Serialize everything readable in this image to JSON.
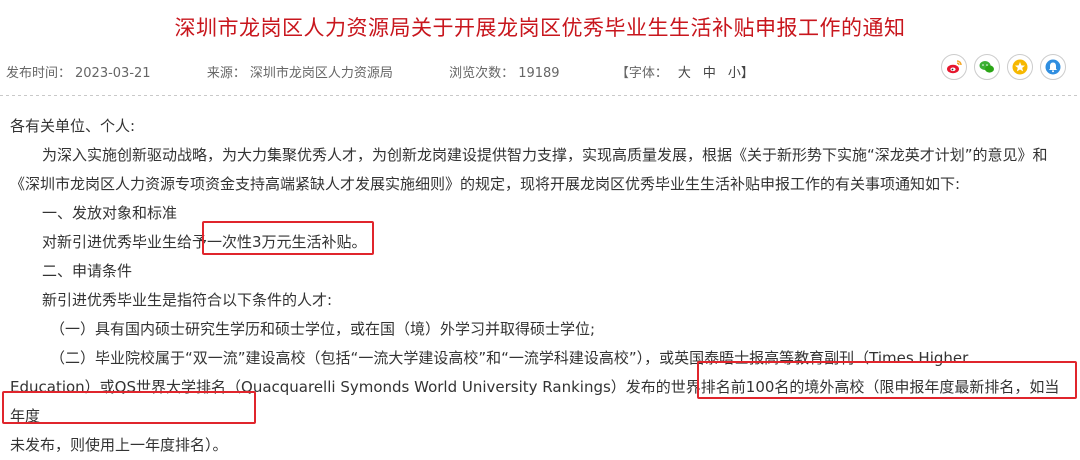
{
  "title": "深圳市龙岗区人力资源局关于开展龙岗区优秀毕业生生活补贴申报工作的通知",
  "meta": {
    "publish_label": "发布时间：",
    "publish_date": "2023-03-21",
    "source_label": "来源：",
    "source": "深圳市龙岗区人力资源局",
    "views_label": "浏览次数：",
    "views": "19189",
    "font_label": "【字体：",
    "font_large": "大",
    "font_medium": "中",
    "font_small": "小】"
  },
  "share": [
    "weibo-icon",
    "wechat-icon",
    "favorite-icon",
    "notify-icon"
  ],
  "body": {
    "salutation": "各有关单位、个人:",
    "intro_1": "为深入实施创新驱动战略，为大力集聚优秀人才，为创新龙岗建设提供智力支撑，实现高质量发展，根据《关于新形势下实施“深龙英才计划”的意见》和",
    "intro_2": "《深圳市龙岗区人力资源专项资金支持高端紧缺人才发展实施细则》的规定，现将开展龙岗区优秀毕业生生活补贴申报工作的有关事项通知如下:",
    "sec1_heading": "一、发放对象和标准",
    "sec1_text": "对新引进优秀毕业生给予一次性3万元生活补贴。",
    "sec2_heading": "二、申请条件",
    "sec2_intro": "新引进优秀毕业生是指符合以下条件的人才:",
    "cond1": "（一）具有国内硕士研究生学历和硕士学位，或在国（境）外学习并取得硕士学位;",
    "cond2_1": "（二）毕业院校属于“双一流”建设高校（包括“一流大学建设高校”和“一流学科建设高校”），或英国泰晤士报高等教育副刊（Times Higher",
    "cond2_2": "Education）或QS世界大学排名（Quacquarelli Symonds World University Rankings）发布的世界排名前100名的境外高校（限申报年度最新排名，如当年度",
    "cond2_3": "未发布，则使用上一年度排名）。"
  }
}
